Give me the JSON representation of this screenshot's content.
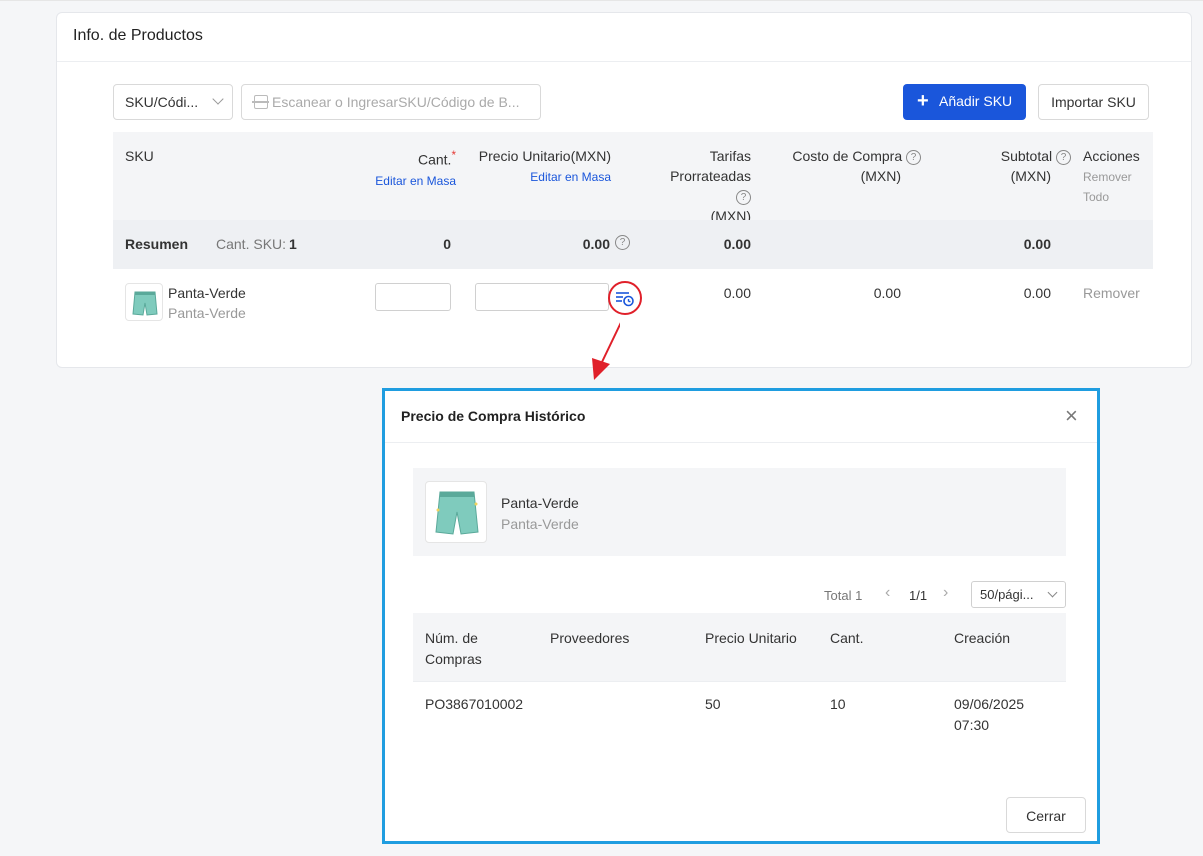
{
  "section_title": "Info. de Productos",
  "toolbar": {
    "select_value": "SKU/Códi...",
    "scan_placeholder": "Escanear o IngresarSKU/Código de B...",
    "add_sku_label": "Añadir SKU",
    "import_sku_label": "Importar SKU"
  },
  "table": {
    "headers": {
      "sku": "SKU",
      "qty": "Cant.",
      "qty_required": "*",
      "qty_bulk": "Editar en Masa",
      "unit_price": "Precio Unitario(MXN)",
      "unit_price_bulk": "Editar en Masa",
      "fees_1": "Tarifas",
      "fees_2": "Prorrateadas",
      "fees_3": "(MXN)",
      "cost_1": "Costo de Compra",
      "cost_2": "(MXN)",
      "subtotal_1": "Subtotal",
      "subtotal_2": "(MXN)",
      "actions": "Acciones",
      "remove_all_1": "Remover",
      "remove_all_2": "Todo"
    },
    "summary": {
      "label": "Resumen",
      "sku_count_label": "Cant. SKU:",
      "sku_count": "1",
      "qty": "0",
      "unit_price": "0.00",
      "fees": "0.00",
      "subtotal": "0.00"
    },
    "rows": [
      {
        "name": "Panta-Verde",
        "code": "Panta-Verde",
        "fees": "0.00",
        "cost": "0.00",
        "subtotal": "0.00",
        "action": "Remover"
      }
    ]
  },
  "modal": {
    "title": "Precio de Compra Histórico",
    "close_icon": "×",
    "product_name": "Panta-Verde",
    "product_code": "Panta-Verde",
    "pager": {
      "total": "Total 1",
      "pages": "1/1",
      "page_size": "50/pági..."
    },
    "headers": {
      "po_1": "Núm. de",
      "po_2": "Compras",
      "supplier": "Proveedores",
      "unit_price": "Precio Unitario",
      "qty": "Cant.",
      "created": "Creación"
    },
    "rows": [
      {
        "po": "PO3867010002",
        "supplier": "",
        "unit_price": "50",
        "qty": "10",
        "date": "09/06/2025",
        "time": "07:30"
      }
    ],
    "close_button": "Cerrar"
  },
  "colors": {
    "primary": "#1a56db",
    "highlight": "#e0202a",
    "modal_border": "#1f9de0"
  }
}
